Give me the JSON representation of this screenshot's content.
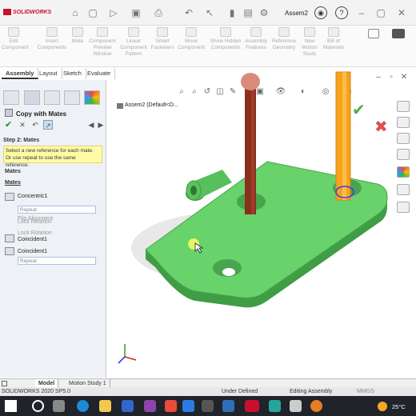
{
  "app": {
    "logo": "SOLIDWORKS",
    "title": "Assem2"
  },
  "commands": [
    {
      "label": "Edit Component"
    },
    {
      "label": "Insert Components"
    },
    {
      "label": "Mate"
    },
    {
      "label": "Component Preview Window"
    },
    {
      "label": "Linear Component Pattern"
    },
    {
      "label": "Smart Fasteners"
    },
    {
      "label": "Move Component"
    },
    {
      "label": "Show Hidden Components"
    },
    {
      "label": "Assembly Features"
    },
    {
      "label": "Reference Geometry"
    },
    {
      "label": "New Motion Study"
    },
    {
      "label": "Bill of Materials"
    }
  ],
  "tabs": [
    "Assembly",
    "Layout",
    "Sketch",
    "Evaluate"
  ],
  "panel": {
    "title": "Copy with Mates",
    "step_title": "Step 2: Mates",
    "hint": "Select a new reference for each mate. Or use repeat to use the same reference.",
    "section_mates": "Mates",
    "section_mates2": "Mates",
    "concentric": "Concentric1",
    "repeat1": "Repeat",
    "flip1": "Flip Alignment",
    "lock1": "Lock Rotation",
    "coincident_top": "Coincident1",
    "lock2": "Lock Rotation",
    "coincident": "Coincident1",
    "repeat2": "Repeat"
  },
  "tree": {
    "label": "Assem2  (Default<D..."
  },
  "bottom_tabs": [
    "Model",
    "Motion Study 1"
  ],
  "status": {
    "version": "SOLIDWORKS 2020 SP5.0",
    "state": "Under Defined",
    "mode": "Editing Assembly",
    "units": "MMGS"
  },
  "taskbar": {
    "temp": "25°C"
  },
  "colors": {
    "part": "#67d36a",
    "pin_brown": "#8a2e1e",
    "pin_orange": "#f6a21b",
    "hint_bg": "#fefba6"
  }
}
